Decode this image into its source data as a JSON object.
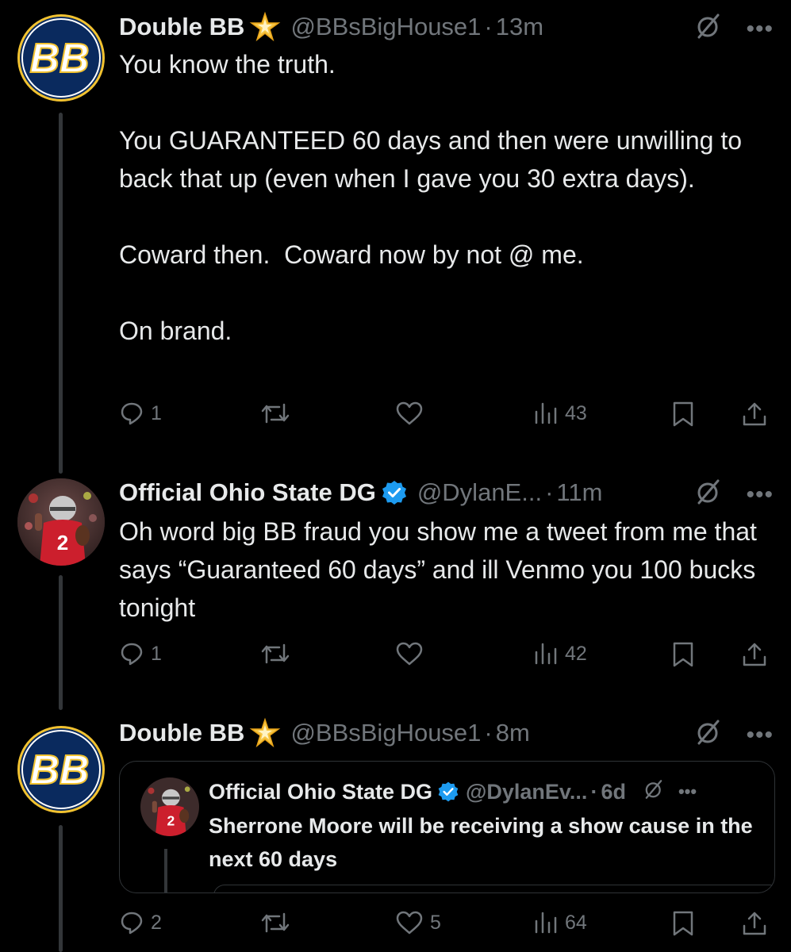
{
  "tweets": [
    {
      "name": "Double BB",
      "handle": "@BBsBigHouse1",
      "dot": "·",
      "time": "13m",
      "avatar_text": "BB",
      "body": "You know the truth.\n\nYou GUARANTEED 60 days and then were unwilling to back that up (even when I gave you 30 extra days).\n\nCoward then.  Coward now by not @ me.\n\nOn brand.",
      "replies": "1",
      "reposts": "",
      "likes": "",
      "views": "43"
    },
    {
      "name": "Official Ohio State DG",
      "handle": "@DylanE...",
      "dot": "·",
      "time": "11m",
      "body": "Oh word big BB fraud you show me a tweet from me that says “Guaranteed 60 days” and ill Venmo you 100 bucks tonight",
      "replies": "1",
      "reposts": "",
      "likes": "",
      "views": "42"
    },
    {
      "name": "Double BB",
      "handle": "@BBsBigHouse1",
      "dot": "·",
      "time": "8m",
      "avatar_text": "BB",
      "quote": {
        "name": "Official Ohio State DG",
        "handle": "@DylanEv...",
        "dot": "·",
        "time": "6d",
        "body": "Sherrone Moore will be receiving a show cause in the next 60 days"
      },
      "replies": "2",
      "reposts": "",
      "likes": "5",
      "views": "64"
    }
  ],
  "colors": {
    "background": "#000000",
    "text": "#e7e9ea",
    "secondary": "#71767b",
    "verified": "#1d9bf0",
    "bb_navy": "#0a2a5e",
    "bb_gold": "#f2c230"
  }
}
